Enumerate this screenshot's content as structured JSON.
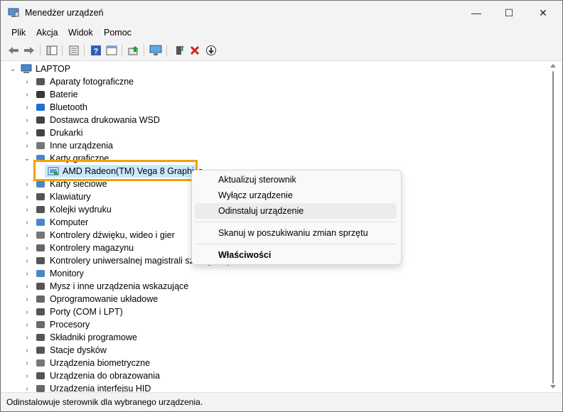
{
  "window": {
    "title": "Menedżer urządzeń",
    "minimize": "—",
    "maximize": "☐",
    "close": "✕"
  },
  "menu": [
    "Plik",
    "Akcja",
    "Widok",
    "Pomoc"
  ],
  "tree": {
    "root": "LAPTOP",
    "categories": [
      "Aparaty fotograficzne",
      "Baterie",
      "Bluetooth",
      "Dostawca drukowania WSD",
      "Drukarki",
      "Inne urządzenia",
      "Karty graficzne",
      "Karty sieciowe",
      "Klawiatury",
      "Kolejki wydruku",
      "Komputer",
      "Kontrolery dźwięku, wideo i gier",
      "Kontrolery magazynu",
      "Kontrolery uniwersalnej magistrali szeregowej",
      "Monitory",
      "Mysz i inne urządzenia wskazujące",
      "Oprogramowanie układowe",
      "Porty (COM i LPT)",
      "Procesory",
      "Składniki programowe",
      "Stacje dysków",
      "Urządzenia biometryczne",
      "Urządzenia do obrazowania",
      "Urządzenia interfejsu HID"
    ],
    "selected_device": "AMD Radeon(TM) Vega 8 Graphics"
  },
  "context_menu": {
    "update_driver": "Aktualizuj sterownik",
    "disable_device": "Wyłącz urządzenie",
    "uninstall_device": "Odinstaluj urządzenie",
    "scan_changes": "Skanuj w poszukiwaniu zmian sprzętu",
    "properties": "Właściwości"
  },
  "status": "Odinstalowuje sterownik dla wybranego urządzenia.",
  "colors": {
    "highlight": "#f5a000",
    "selection": "#cce8ff"
  }
}
